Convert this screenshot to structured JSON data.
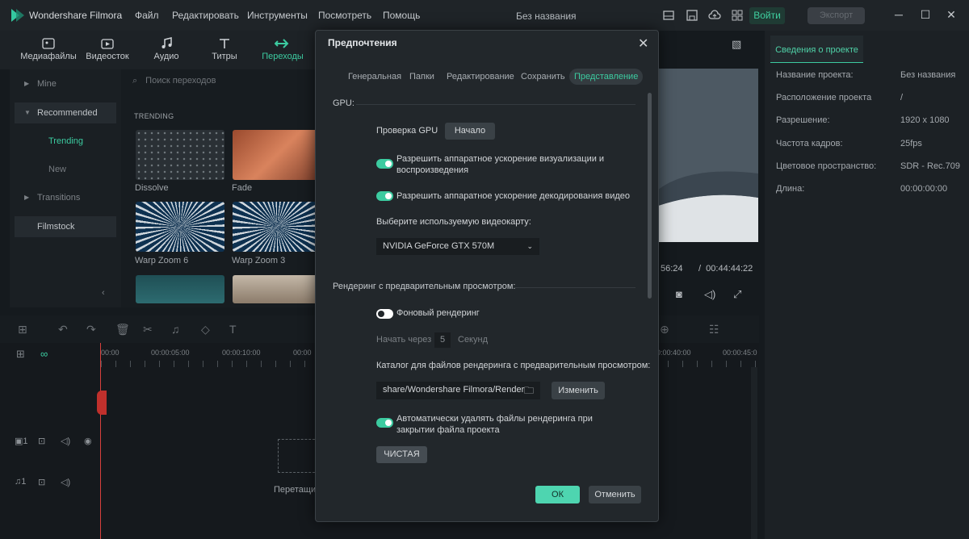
{
  "app": {
    "name": "Wondershare Filmora",
    "window_title": "Без названия",
    "menu": [
      "Файл",
      "Редактировать",
      "Инструменты",
      "Посмотреть",
      "Помощь"
    ],
    "login": "Войти",
    "export": "Экспорт"
  },
  "toolbar": {
    "tabs": [
      "Медиафайлы",
      "Видеосток",
      "Аудио",
      "Титры",
      "Переходы"
    ],
    "active": "Переходы"
  },
  "left_panel": {
    "items": [
      "Mine",
      "Recommended",
      "Transitions",
      "Filmstock"
    ],
    "sub_items": [
      "Trending",
      "New"
    ]
  },
  "media": {
    "search_placeholder": "Поиск переходов",
    "section": "TRENDING",
    "thumbnails": [
      "Dissolve",
      "Fade",
      "Warp Zoom 6",
      "Warp Zoom 3"
    ]
  },
  "right_panel": {
    "tab": "Сведения о проекте",
    "rows": [
      {
        "key": "Название проекта:",
        "value": "Без названия"
      },
      {
        "key": "Расположение проектa",
        "value": "/"
      },
      {
        "key": "Разрешение:",
        "value": "1920 x 1080"
      },
      {
        "key": "Частота кадров:",
        "value": "25fps"
      },
      {
        "key": "Цветовое пространство:",
        "value": "SDR - Rec.709"
      },
      {
        "key": "Длина:",
        "value": "00:00:00:00"
      }
    ]
  },
  "player": {
    "current_time_fragment": "56:24",
    "total_time": "00:44:44:22"
  },
  "timeline": {
    "ruler": [
      "00:00",
      "00:00:05:00",
      "00:00:10:00",
      "00:00",
      "00:00:40:00",
      "00:00:45:0"
    ],
    "drop_hint": "Перетащи"
  },
  "dialog": {
    "title": "Предпочтения",
    "tabs": [
      "Генеральная",
      "Папки",
      "Редактирование",
      "Сохранить",
      "Представление"
    ],
    "active_tab": "Представление",
    "gpu_section": "GPU:",
    "gpu_check_label": "Проверка GPU",
    "gpu_check_button": "Начало",
    "hw_accel_render": "Разрешить аппаратное ускорение визуализации и воспроизведения",
    "hw_accel_decode": "Разрешить аппаратное ускорение декодирования видео",
    "gpu_select_label": "Выберите используемую видеокарту:",
    "gpu_selected": "NVIDIA GeForce GTX 570M",
    "render_section": "Рендеринг с предварительным просмотром:",
    "bg_render": "Фоновый рендеринг",
    "start_after": "Начать через",
    "start_after_value": "5",
    "seconds": "Секунд",
    "render_dir_label": "Каталог для файлов рендеринга с предварительным просмотром:",
    "render_dir_value": "share/Wondershare Filmora/Render",
    "change_button": "Изменить",
    "auto_delete": "Автоматически удалять файлы рендеринга при закрытии файла проекта",
    "clean_button": "ЧИСТАЯ",
    "ok": "ОК",
    "cancel": "Отменить",
    "toggles": {
      "hw_accel_render": true,
      "hw_accel_decode": true,
      "bg_render": false,
      "auto_delete": true
    }
  }
}
